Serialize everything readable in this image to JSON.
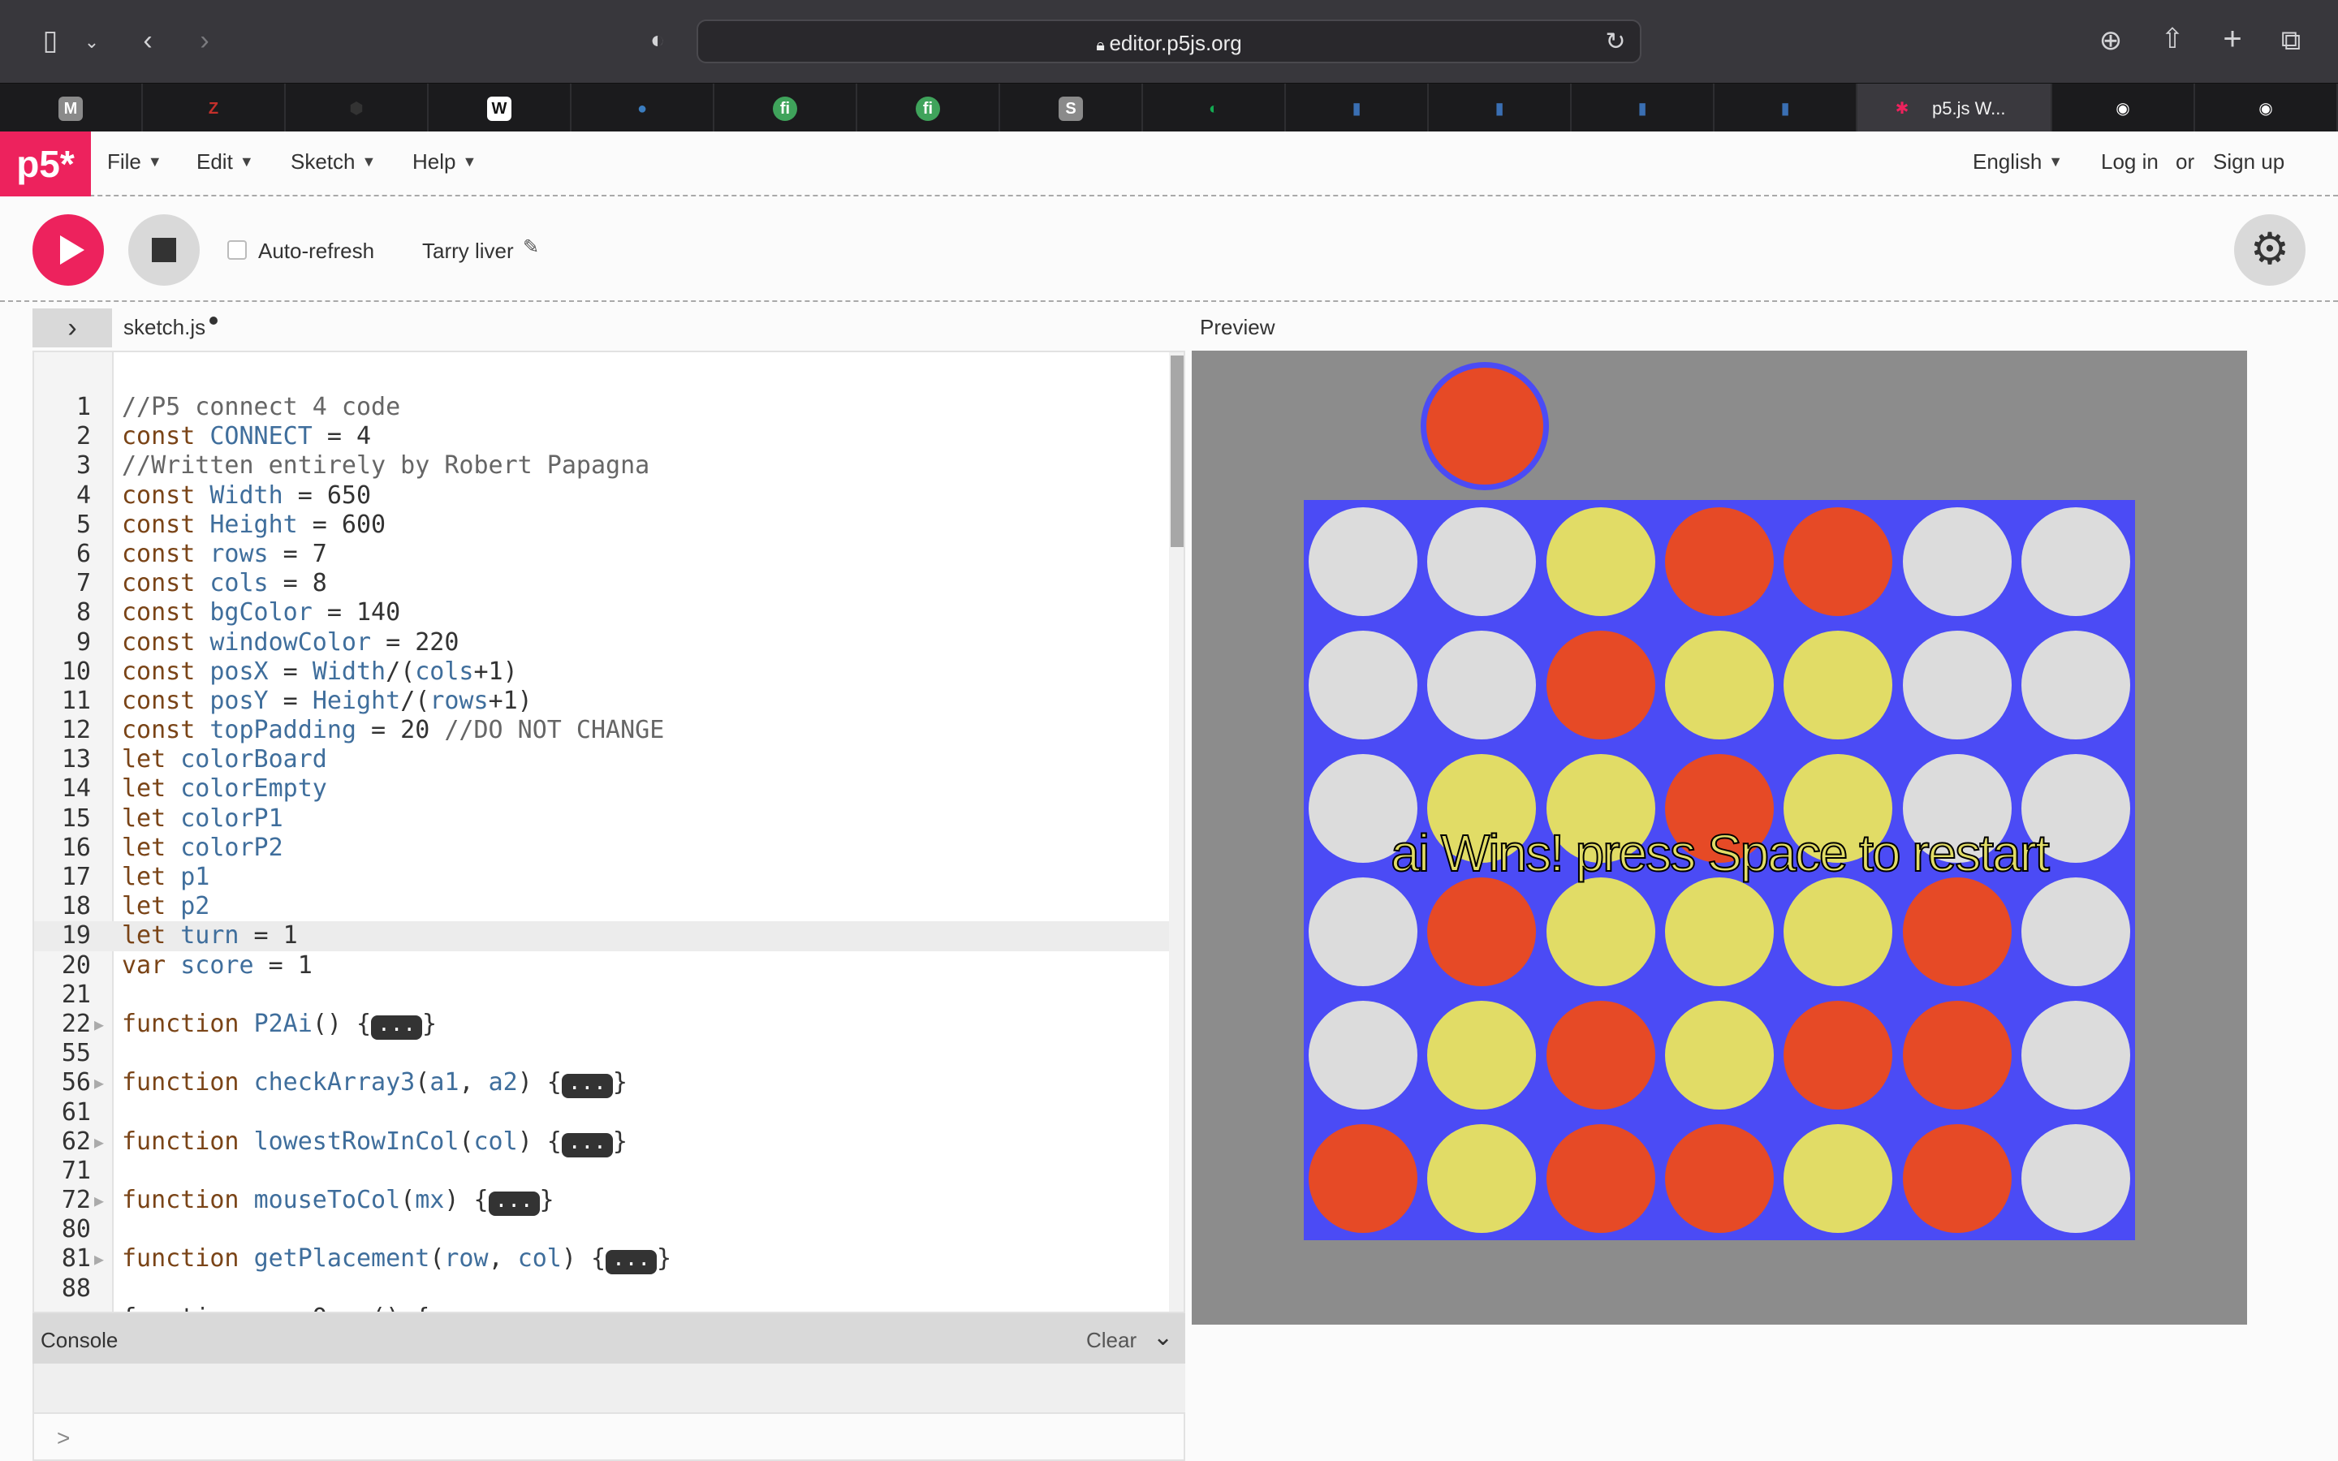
{
  "browser": {
    "url": "editor.p5js.org",
    "icons": [
      "sidebar-icon",
      "chevron-down-icon",
      "back-icon",
      "forward-icon",
      "shield-icon",
      "lock-icon",
      "reload-icon",
      "download-icon",
      "share-icon",
      "new-tab-icon",
      "tabs-overview-icon"
    ],
    "tabs": [
      {
        "icon": "M",
        "color": "#8a8a8a"
      },
      {
        "icon": "Z",
        "color": "#c4302b"
      },
      {
        "icon": "⬢",
        "color": "#333333"
      },
      {
        "icon": "W",
        "color": "#ffffff"
      },
      {
        "icon": "●",
        "color": "#3b7dbf"
      },
      {
        "icon": "fi",
        "color": "#3fa35b"
      },
      {
        "icon": "fi",
        "color": "#3fa35b"
      },
      {
        "icon": "S",
        "color": "#8a8a8a"
      },
      {
        "icon": "◐",
        "color": "#13aa52"
      },
      {
        "icon": "▮",
        "color": "#3a6fb3"
      },
      {
        "icon": "▮",
        "color": "#3a6fb3"
      },
      {
        "icon": "▮",
        "color": "#3a6fb3"
      },
      {
        "icon": "▮",
        "color": "#3a6fb3"
      },
      {
        "icon": "✱",
        "color": "#ed225d",
        "label": "p5.js W...",
        "active": true
      },
      {
        "icon": "◉",
        "color": "#ffffff"
      },
      {
        "icon": "◉",
        "color": "#ffffff"
      }
    ]
  },
  "nav": {
    "logo": "p5*",
    "menus": [
      "File",
      "Edit",
      "Sketch",
      "Help"
    ],
    "language": "English",
    "login": "Log in",
    "or": "or",
    "signup": "Sign up"
  },
  "toolbar": {
    "autorefresh_label": "Auto-refresh",
    "autorefresh_checked": false,
    "sketch_name": "Tarry liver"
  },
  "editor": {
    "filename": "sketch.js",
    "active_line": "19",
    "lines": [
      {
        "n": "1",
        "text": "//P5 connect 4 code",
        "type": "comment"
      },
      {
        "n": "2",
        "text": "const CONNECT = 4"
      },
      {
        "n": "3",
        "text": "//Written entirely by Robert Papagna",
        "type": "comment"
      },
      {
        "n": "4",
        "text": "const Width = 650"
      },
      {
        "n": "5",
        "text": "const Height = 600"
      },
      {
        "n": "6",
        "text": "const rows = 7"
      },
      {
        "n": "7",
        "text": "const cols = 8"
      },
      {
        "n": "8",
        "text": "const bgColor = 140"
      },
      {
        "n": "9",
        "text": "const windowColor = 220"
      },
      {
        "n": "10",
        "text": "const posX = Width/(cols+1)"
      },
      {
        "n": "11",
        "text": "const posY = Height/(rows+1)"
      },
      {
        "n": "12",
        "text": "const topPadding = 20 //DO NOT CHANGE"
      },
      {
        "n": "13",
        "text": "let colorBoard"
      },
      {
        "n": "14",
        "text": "let colorEmpty"
      },
      {
        "n": "15",
        "text": "let colorP1"
      },
      {
        "n": "16",
        "text": "let colorP2"
      },
      {
        "n": "17",
        "text": "let p1"
      },
      {
        "n": "18",
        "text": "let p2"
      },
      {
        "n": "19",
        "text": "let turn = 1"
      },
      {
        "n": "20",
        "text": "var score = 1"
      },
      {
        "n": "21",
        "text": ""
      },
      {
        "n": "22",
        "text": "function P2Ai() {",
        "folded": true
      },
      {
        "n": "55",
        "text": ""
      },
      {
        "n": "56",
        "text": "function checkArray3(a1, a2) {",
        "folded": true
      },
      {
        "n": "61",
        "text": ""
      },
      {
        "n": "62",
        "text": "function lowestRowInCol(col) {",
        "folded": true
      },
      {
        "n": "71",
        "text": ""
      },
      {
        "n": "72",
        "text": "function mouseToCol(mx) {",
        "folded": true
      },
      {
        "n": "80",
        "text": ""
      },
      {
        "n": "81",
        "text": "function getPlacement(row, col) {",
        "folded": true
      },
      {
        "n": "88",
        "text": ""
      }
    ],
    "fold_marker": "...",
    "cut_off_line_text": "function gameOver() {"
  },
  "console": {
    "label": "Console",
    "clear": "Clear",
    "prompt": ">"
  },
  "preview": {
    "label": "Preview",
    "message": "ai Wins! press Space to restart",
    "colors": {
      "background": "#8c8c8c",
      "board": "#4b4bf5",
      "empty": "#dcdcdc",
      "red": "#e64a26",
      "yellow": "#e1dc66"
    },
    "hover_piece": "red",
    "grid": [
      [
        "E",
        "E",
        "Y",
        "R",
        "R",
        "E",
        "E"
      ],
      [
        "E",
        "E",
        "R",
        "Y",
        "Y",
        "E",
        "E"
      ],
      [
        "E",
        "Y",
        "Y",
        "R",
        "Y",
        "E",
        "E"
      ],
      [
        "E",
        "R",
        "Y",
        "Y",
        "Y",
        "R",
        "E"
      ],
      [
        "E",
        "Y",
        "R",
        "Y",
        "R",
        "R",
        "E"
      ],
      [
        "R",
        "Y",
        "R",
        "R",
        "Y",
        "R",
        "E"
      ]
    ]
  }
}
